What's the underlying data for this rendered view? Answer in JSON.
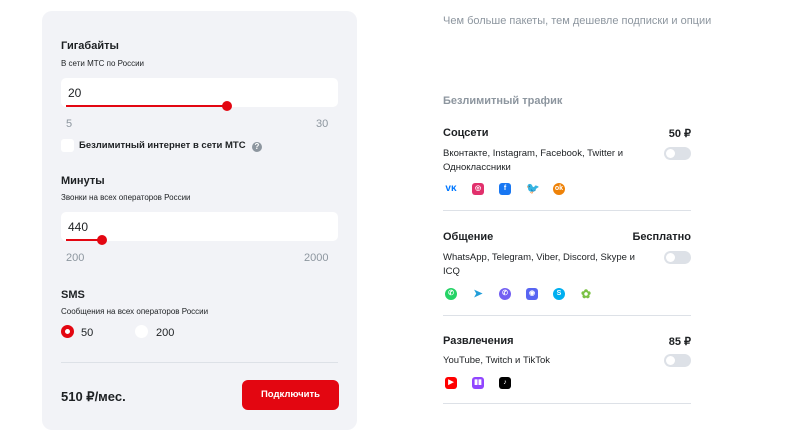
{
  "gigabytes": {
    "title": "Гигабайты",
    "subtitle": "В сети МТС по России",
    "value": "20",
    "min": "5",
    "max": "30",
    "level": 0.6,
    "unlimited_label": "Безлимитный интернет в сети МТС",
    "help": "?"
  },
  "minutes": {
    "title": "Минуты",
    "subtitle": "Звонки на всех операторов России",
    "value": "440",
    "min": "200",
    "max": "2000",
    "level": 0.13
  },
  "sms": {
    "title": "SMS",
    "subtitle": "Сообщения на всех операторов России",
    "options": [
      {
        "label": "50",
        "selected": true
      },
      {
        "label": "200",
        "selected": false
      }
    ]
  },
  "footer": {
    "price": "510 ₽/мес.",
    "connect_label": "Подключить"
  },
  "note": "Чем больше пакеты, тем дешевле подписки и опции",
  "unlimited": {
    "title": "Безлимитный трафик",
    "options": [
      {
        "title": "Соцсети",
        "price": "50 ₽",
        "desc": "Вконтакте, Instagram, Facebook, Twitter и Одноклассники",
        "enabled": false,
        "icons": [
          "vk-icon",
          "instagram-icon",
          "facebook-icon",
          "twitter-icon",
          "odnoklassniki-icon"
        ]
      },
      {
        "title": "Общение",
        "price": "Бесплатно",
        "desc": "WhatsApp, Telegram, Viber, Discord, Skype и ICQ",
        "enabled": false,
        "icons": [
          "whatsapp-icon",
          "telegram-icon",
          "viber-icon",
          "discord-icon",
          "skype-icon",
          "icq-icon"
        ]
      },
      {
        "title": "Развлечения",
        "price": "85 ₽",
        "desc": "YouTube, Twitch и TikTok",
        "enabled": false,
        "icons": [
          "youtube-icon",
          "twitch-icon",
          "tiktok-icon"
        ]
      }
    ]
  },
  "colors": {
    "accent": "#e30611",
    "card_bg": "#f2f3f7",
    "muted_text": "#8d969f"
  }
}
